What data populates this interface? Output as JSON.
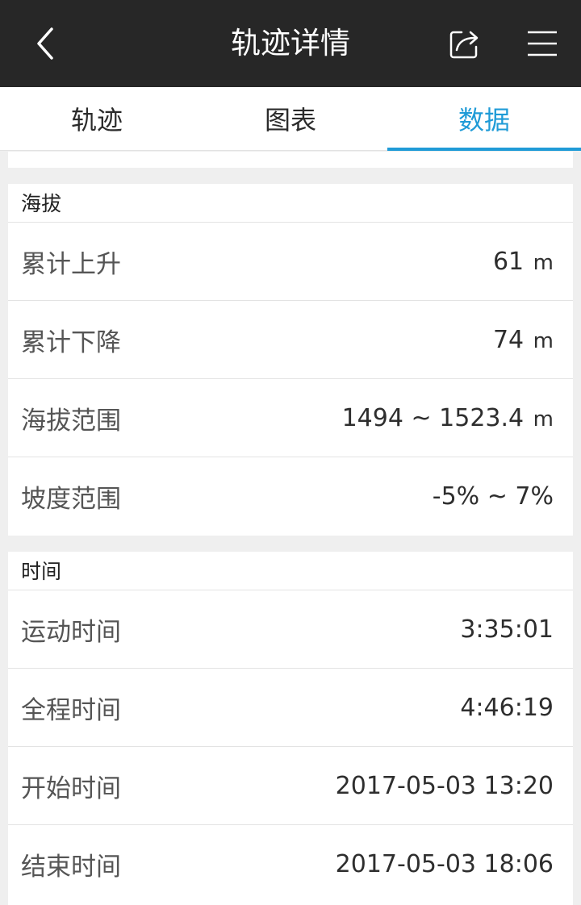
{
  "header": {
    "title": "轨迹详情",
    "back_icon": "chevron-left-icon",
    "share_icon": "share-icon",
    "menu_icon": "hamburger-menu-icon"
  },
  "tabs": [
    {
      "label": "轨迹",
      "active": false
    },
    {
      "label": "图表",
      "active": false
    },
    {
      "label": "数据",
      "active": true
    }
  ],
  "colors": {
    "header_bg": "#272727",
    "accent": "#1f9bd7",
    "page_bg": "#efefef"
  },
  "sections": {
    "elevation": {
      "title": "海拔",
      "rows": [
        {
          "label": "累计上升",
          "value": "61",
          "unit": "m"
        },
        {
          "label": "累计下降",
          "value": "74",
          "unit": "m"
        },
        {
          "label": "海拔范围",
          "value": "1494 ~ 1523.4",
          "unit": "m"
        },
        {
          "label": "坡度范围",
          "value": "-5% ~ 7%",
          "unit": ""
        }
      ]
    },
    "time": {
      "title": "时间",
      "rows": [
        {
          "label": "运动时间",
          "value": "3:35:01"
        },
        {
          "label": "全程时间",
          "value": "4:46:19"
        },
        {
          "label": "开始时间",
          "value": "2017-05-03 13:20"
        },
        {
          "label": "结束时间",
          "value": "2017-05-03 18:06"
        }
      ]
    }
  }
}
